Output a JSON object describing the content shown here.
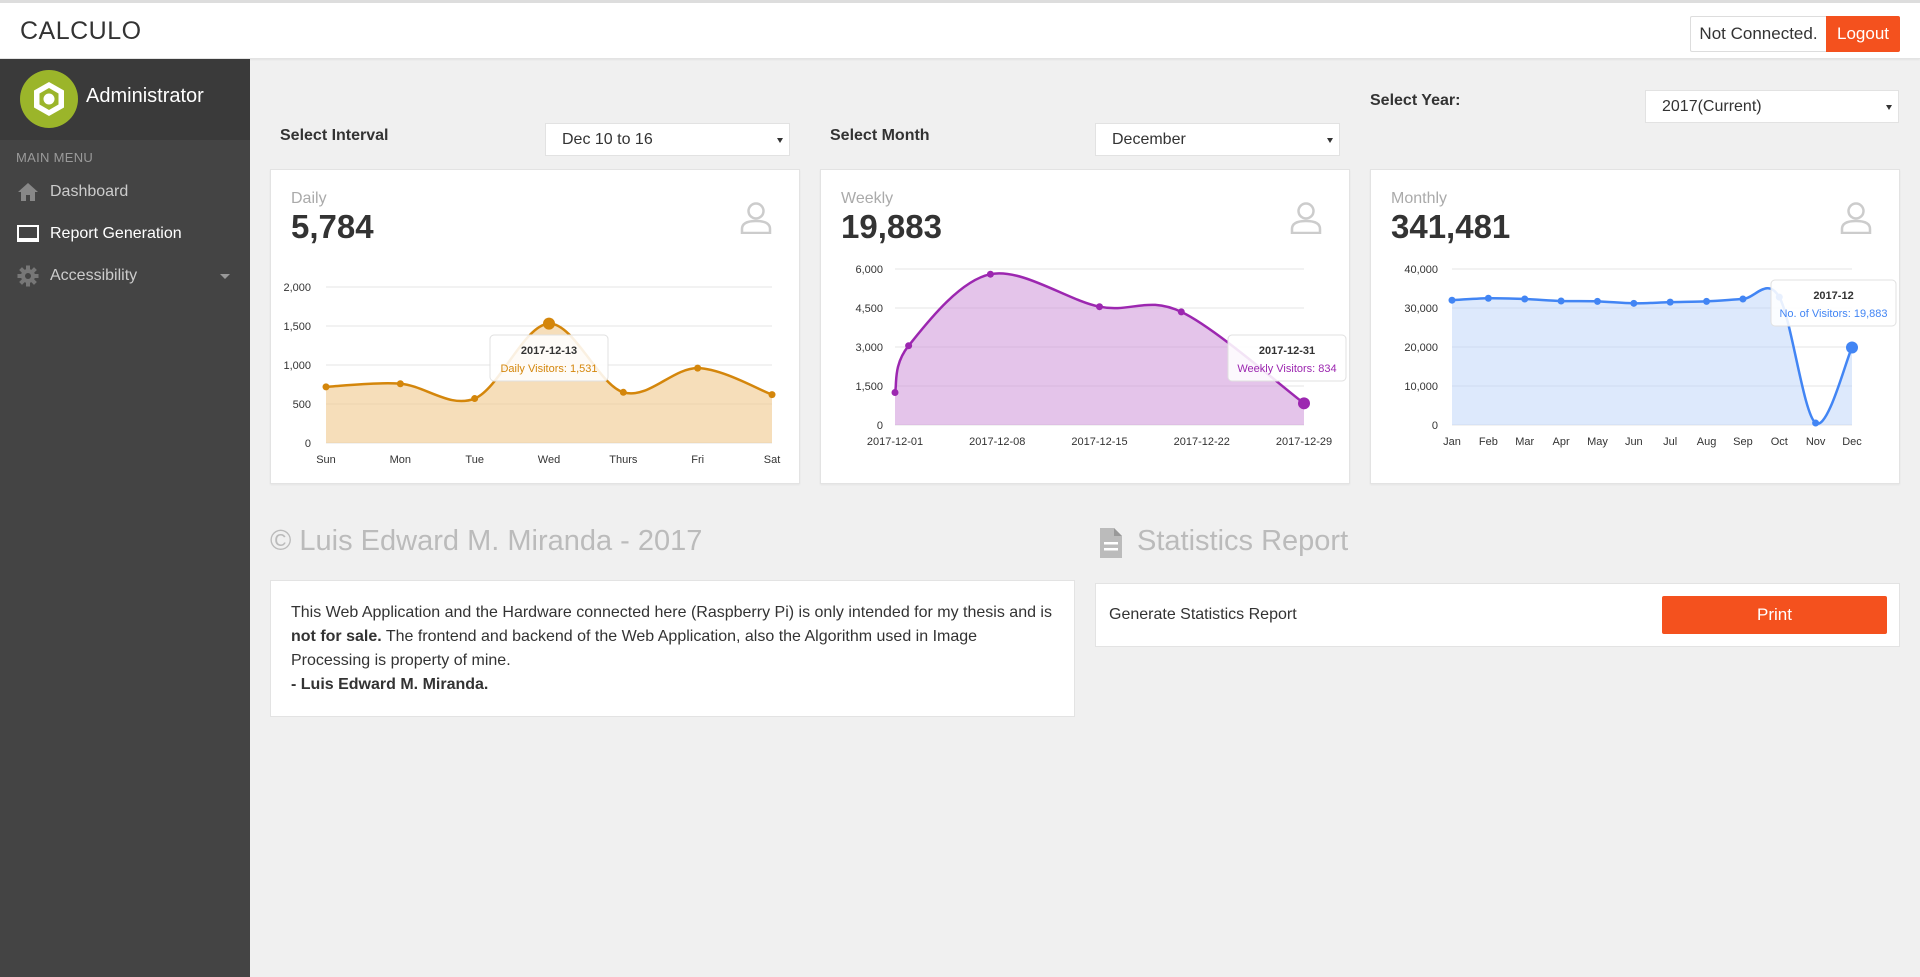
{
  "app": {
    "brand": "CALCULO"
  },
  "header": {
    "connection_status": "Not Connected.",
    "logout_label": "Logout"
  },
  "sidebar": {
    "user_name": "Administrator",
    "menu_header": "MAIN MENU",
    "items": [
      {
        "label": "Dashboard",
        "icon": "home-icon"
      },
      {
        "label": "Report Generation",
        "icon": "monitor-icon",
        "active": true
      },
      {
        "label": "Accessibility",
        "icon": "gear-icon"
      }
    ]
  },
  "filters": {
    "interval_label": "Select Interval",
    "interval_value": "Dec 10 to 16",
    "month_label": "Select Month",
    "month_value": "December",
    "year_label": "Select Year:",
    "year_value": "2017(Current)"
  },
  "cards": {
    "daily": {
      "title": "Daily",
      "value": "5,784",
      "tooltip_title": "2017-12-13",
      "tooltip_text": "Daily Visitors: 1,531"
    },
    "weekly": {
      "title": "Weekly",
      "value": "19,883",
      "tooltip_title": "2017-12-31",
      "tooltip_text": "Weekly Visitors: 834"
    },
    "monthly": {
      "title": "Monthly",
      "value": "341,481",
      "tooltip_title": "2017-12",
      "tooltip_text": "No. of Visitors: 19,883"
    }
  },
  "colors": {
    "daily": "#d4860b",
    "weekly": "#9c27b0",
    "monthly": "#4285f4",
    "accent": "#f4511e"
  },
  "chart_data": [
    {
      "type": "area",
      "categories": [
        "Sun",
        "Mon",
        "Tue",
        "Wed",
        "Thurs",
        "Fri",
        "Sat"
      ],
      "series": [
        {
          "name": "Daily Visitors",
          "values": [
            720,
            760,
            570,
            1531,
            650,
            960,
            620
          ]
        }
      ],
      "yticks": [
        "0",
        "500",
        "1,000",
        "1,500",
        "2,000"
      ],
      "ylim": [
        0,
        2000
      ]
    },
    {
      "type": "area",
      "categories": [
        "2017-12-01",
        "2017-12-08",
        "2017-12-15",
        "2017-12-22",
        "2017-12-29"
      ],
      "x": [
        1,
        2,
        8,
        16,
        22,
        31
      ],
      "series": [
        {
          "name": "Weekly Visitors",
          "values": [
            1250,
            3050,
            5800,
            4550,
            4350,
            834
          ]
        }
      ],
      "yticks": [
        "0",
        "1,500",
        "3,000",
        "4,500",
        "6,000"
      ],
      "ylim": [
        0,
        6000
      ]
    },
    {
      "type": "area",
      "categories": [
        "Jan",
        "Feb",
        "Mar",
        "Apr",
        "May",
        "Jun",
        "Jul",
        "Aug",
        "Sep",
        "Oct",
        "Nov",
        "Dec"
      ],
      "series": [
        {
          "name": "No. of Visitors",
          "values": [
            32000,
            32500,
            32300,
            31800,
            31700,
            31200,
            31500,
            31700,
            32300,
            32800,
            500,
            19883
          ]
        }
      ],
      "yticks": [
        "0",
        "10,000",
        "20,000",
        "30,000",
        "40,000"
      ],
      "ylim": [
        0,
        40000
      ]
    }
  ],
  "footer": {
    "copyright": "© Luis Edward M. Miranda - 2017",
    "about_line1": "This Web Application and the Hardware connected here (Raspberry Pi) is only intended for my thesis and is",
    "about_bold": "not for sale.",
    "about_line2": " The frontend and backend of the Web Application, also the Algorithm used in Image Processing is property of mine.",
    "about_sign": "- Luis Edward M. Miranda."
  },
  "report": {
    "title": "Statistics Report",
    "row_label": "Generate Statistics Report",
    "print_label": "Print"
  }
}
